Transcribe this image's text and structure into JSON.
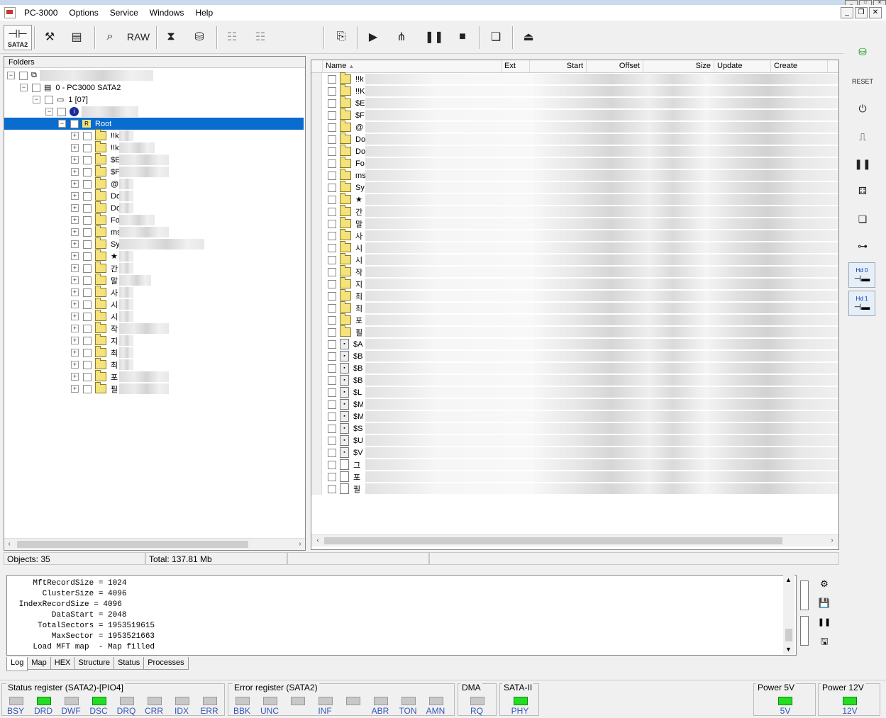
{
  "app": {
    "title": "PC-3000"
  },
  "menu": [
    "Options",
    "Service",
    "Windows",
    "Help"
  ],
  "toolbar": {
    "sata_label": "SATA2",
    "raw_label": "RAW"
  },
  "left_panel": {
    "header": "Folders",
    "device": "0 - PC3000 SATA2",
    "partition": "1 [07]",
    "root": "Root",
    "root_badge": "R",
    "folders": [
      "!!k",
      "!!k",
      "$E",
      "$F",
      "@",
      "Do",
      "Do",
      "Fo",
      "ms",
      "Sy",
      "★",
      "간",
      "말",
      "사",
      "시",
      "시",
      "작",
      "지",
      "최",
      "최",
      "포",
      "필"
    ]
  },
  "right_panel": {
    "columns": [
      "Name",
      "Ext",
      "Start",
      "Offset",
      "Size",
      "Update",
      "Create"
    ],
    "folders": [
      "!!k",
      "!!K",
      "$E",
      "$F",
      "@",
      "Do",
      "Do",
      "Fo",
      "ms",
      "Sy",
      "★",
      "간",
      "말",
      "사",
      "시",
      "시",
      "작",
      "지",
      "최",
      "최",
      "포",
      "필"
    ],
    "files": [
      "$A",
      "$B",
      "$B",
      "$B",
      "$L",
      "$M",
      "$M",
      "$S",
      "$U",
      "$V",
      "그",
      "포",
      "필"
    ]
  },
  "status": {
    "objects": "Objects: 35",
    "total": "Total: 137.81 Mb"
  },
  "log": {
    "lines": [
      "    MftRecordSize = 1024",
      "      ClusterSize = 4096",
      " IndexRecordSize = 4096",
      "        DataStart = 2048",
      "     TotalSectors = 1953519615",
      "        MaxSector = 1953521663",
      "    Load MFT map  - Map filled"
    ]
  },
  "tabs": [
    "Log",
    "Map",
    "HEX",
    "Structure",
    "Status",
    "Processes"
  ],
  "registers": {
    "status_title": "Status register (SATA2)-[PIO4]",
    "status": [
      {
        "label": "BSY",
        "on": false
      },
      {
        "label": "DRD",
        "on": true
      },
      {
        "label": "DWF",
        "on": false
      },
      {
        "label": "DSC",
        "on": true
      },
      {
        "label": "DRQ",
        "on": false
      },
      {
        "label": "CRR",
        "on": false
      },
      {
        "label": "IDX",
        "on": false
      },
      {
        "label": "ERR",
        "on": false
      }
    ],
    "error_title": "Error register (SATA2)",
    "error": [
      {
        "label": "BBK",
        "on": false
      },
      {
        "label": "UNC",
        "on": false
      },
      {
        "label": "",
        "on": false
      },
      {
        "label": "INF",
        "on": false
      },
      {
        "label": "",
        "on": false
      },
      {
        "label": "ABR",
        "on": false
      },
      {
        "label": "TON",
        "on": false
      },
      {
        "label": "AMN",
        "on": false
      }
    ],
    "dma_title": "DMA",
    "dma_label": "RQ",
    "sata_title": "SATA-II",
    "sata_label": "PHY",
    "p5_title": "Power 5V",
    "p5_label": "5V",
    "p12_title": "Power 12V",
    "p12_label": "12V"
  },
  "right_toolbar": {
    "hd0": "Hd 0",
    "hd1": "Hd 1"
  },
  "colors": {
    "selection": "#0a6ccf",
    "led_on": "#22dd22",
    "folder": "#f4e27a"
  }
}
